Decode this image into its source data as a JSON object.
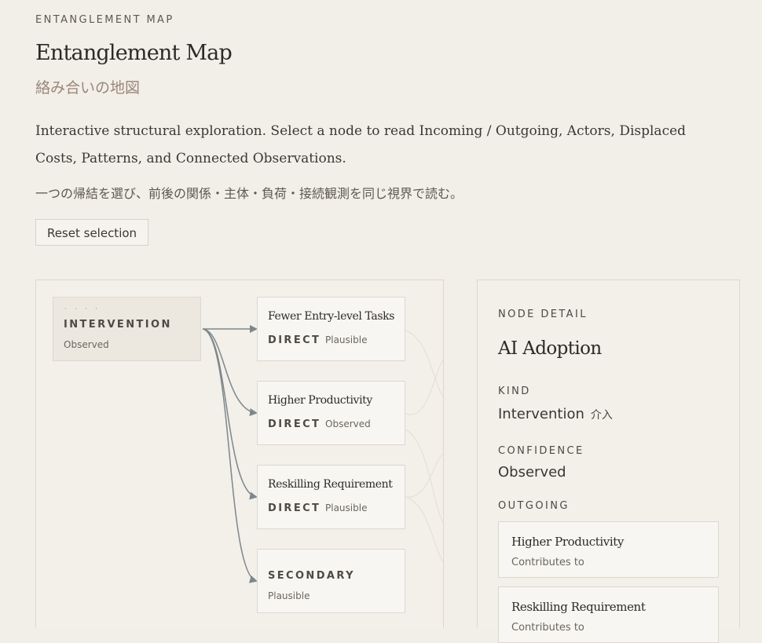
{
  "header": {
    "eyebrow": "ENTANGLEMENT MAP",
    "title": "Entanglement Map",
    "subtitle": "絡み合いの地図",
    "description": "Interactive structural exploration. Select a node to read Incoming / Outgoing, Actors, Displaced Costs, Patterns, and Connected Observations.",
    "description_ja": "一つの帰結を選び、前後の関係・主体・負荷・接続観測を同じ視界で読む。",
    "reset_label": "Reset selection"
  },
  "map": {
    "source_node": {
      "tag": "INTERVENTION",
      "confidence": "Observed"
    },
    "nodes": [
      {
        "label": "Fewer Entry-level Tasks",
        "tag": "DIRECT",
        "confidence": "Plausible"
      },
      {
        "label": "Higher Productivity",
        "tag": "DIRECT",
        "confidence": "Observed"
      },
      {
        "label": "Reskilling Requirement",
        "tag": "DIRECT",
        "confidence": "Plausible"
      }
    ],
    "secondary_node": {
      "tag": "SECONDARY",
      "confidence": "Plausible"
    }
  },
  "detail": {
    "eyebrow": "NODE DETAIL",
    "title": "AI Adoption",
    "kind_label": "KIND",
    "kind_value": "Intervention",
    "kind_value_ja": "介入",
    "confidence_label": "CONFIDENCE",
    "confidence_value": "Observed",
    "outgoing_label": "OUTGOING",
    "outgoing": [
      {
        "label": "Higher Productivity",
        "relation": "Contributes to"
      },
      {
        "label": "Reskilling Requirement",
        "relation": "Contributes to"
      }
    ]
  },
  "colors": {
    "background": "#f2eee8",
    "edge": "#7d878c",
    "border": "#ddd7d0"
  }
}
